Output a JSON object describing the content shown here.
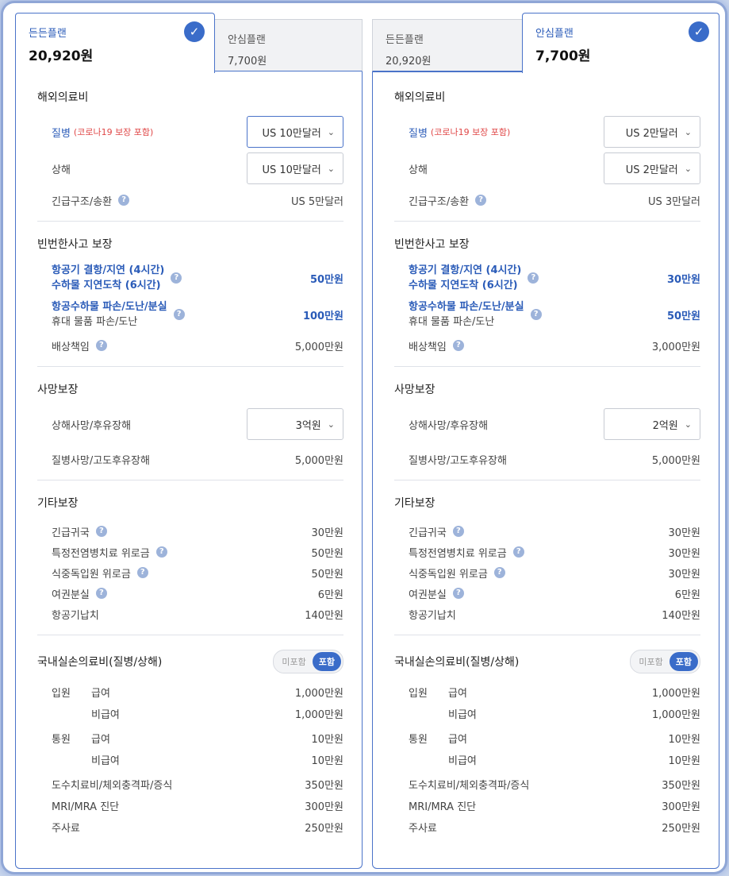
{
  "plans": [
    {
      "active_tab": {
        "name": "든든플랜",
        "price": "20,920원"
      },
      "inactive_tab": {
        "name": "안심플랜",
        "price": "7,700원"
      },
      "overseas": {
        "title": "해외의료비",
        "illness_label": "질병",
        "illness_note": "(코로나19 보장 포함)",
        "illness_value": "US 10만달러",
        "injury_label": "상해",
        "injury_value": "US 10만달러",
        "rescue_label": "긴급구조/송환",
        "rescue_value": "US 5만달러"
      },
      "frequent": {
        "title": "빈번한사고 보장",
        "flight_l1": "항공기 결항/지연 (4시간)",
        "flight_l2": "수하물 지연도착 (6시간)",
        "flight_value": "50만원",
        "baggage_l1": "항공수하물 파손/도난/분실",
        "baggage_l2": "휴대 물품 파손/도난",
        "baggage_value": "100만원",
        "liability_label": "배상책임",
        "liability_value": "5,000만원"
      },
      "death": {
        "title": "사망보장",
        "injury_label": "상해사망/후유장해",
        "injury_value": "3억원",
        "illness_label": "질병사망/고도후유장해",
        "illness_value": "5,000만원"
      },
      "other": {
        "title": "기타보장",
        "items": [
          {
            "label": "긴급귀국",
            "value": "30만원"
          },
          {
            "label": "특정전염병치료 위로금",
            "value": "50만원"
          },
          {
            "label": "식중독입원 위로금",
            "value": "50만원"
          },
          {
            "label": "여권분실",
            "value": "6만원"
          },
          {
            "label": "항공기납치",
            "value": "140만원"
          }
        ]
      },
      "domestic": {
        "title": "국내실손의료비(질병/상해)",
        "toggle_off": "미포함",
        "toggle_on": "포함",
        "inpatient": "입원",
        "outpatient": "통원",
        "covered": "급여",
        "noncovered": "비급여",
        "inpatient_covered": "1,000만원",
        "inpatient_noncovered": "1,000만원",
        "outpatient_covered": "10만원",
        "outpatient_noncovered": "10만원",
        "extra": [
          {
            "label": "도수치료비/체외충격파/증식",
            "value": "350만원"
          },
          {
            "label": "MRI/MRA 진단",
            "value": "300만원"
          },
          {
            "label": "주사료",
            "value": "250만원"
          }
        ]
      }
    },
    {
      "active_tab": {
        "name": "안심플랜",
        "price": "7,700원"
      },
      "inactive_tab": {
        "name": "든든플랜",
        "price": "20,920원"
      },
      "overseas": {
        "title": "해외의료비",
        "illness_label": "질병",
        "illness_note": "(코로나19 보장 포함)",
        "illness_value": "US 2만달러",
        "injury_label": "상해",
        "injury_value": "US 2만달러",
        "rescue_label": "긴급구조/송환",
        "rescue_value": "US 3만달러"
      },
      "frequent": {
        "title": "빈번한사고 보장",
        "flight_l1": "항공기 결항/지연 (4시간)",
        "flight_l2": "수하물 지연도착 (6시간)",
        "flight_value": "30만원",
        "baggage_l1": "항공수하물 파손/도난/분실",
        "baggage_l2": "휴대 물품 파손/도난",
        "baggage_value": "50만원",
        "liability_label": "배상책임",
        "liability_value": "3,000만원"
      },
      "death": {
        "title": "사망보장",
        "injury_label": "상해사망/후유장해",
        "injury_value": "2억원",
        "illness_label": "질병사망/고도후유장해",
        "illness_value": "5,000만원"
      },
      "other": {
        "title": "기타보장",
        "items": [
          {
            "label": "긴급귀국",
            "value": "30만원"
          },
          {
            "label": "특정전염병치료 위로금",
            "value": "30만원"
          },
          {
            "label": "식중독입원 위로금",
            "value": "30만원"
          },
          {
            "label": "여권분실",
            "value": "6만원"
          },
          {
            "label": "항공기납치",
            "value": "140만원"
          }
        ]
      },
      "domestic": {
        "title": "국내실손의료비(질병/상해)",
        "toggle_off": "미포함",
        "toggle_on": "포함",
        "inpatient": "입원",
        "outpatient": "통원",
        "covered": "급여",
        "noncovered": "비급여",
        "inpatient_covered": "1,000만원",
        "inpatient_noncovered": "1,000만원",
        "outpatient_covered": "10만원",
        "outpatient_noncovered": "10만원",
        "extra": [
          {
            "label": "도수치료비/체외충격파/증식",
            "value": "350만원"
          },
          {
            "label": "MRI/MRA 진단",
            "value": "300만원"
          },
          {
            "label": "주사료",
            "value": "250만원"
          }
        ]
      }
    }
  ],
  "icons": {
    "check": "check-icon",
    "help": "help-icon",
    "chevron": "chevron-down-icon"
  },
  "colors": {
    "accent": "#3a6cc9",
    "note_red": "#e04848",
    "text_blue": "#2a5bb8"
  }
}
